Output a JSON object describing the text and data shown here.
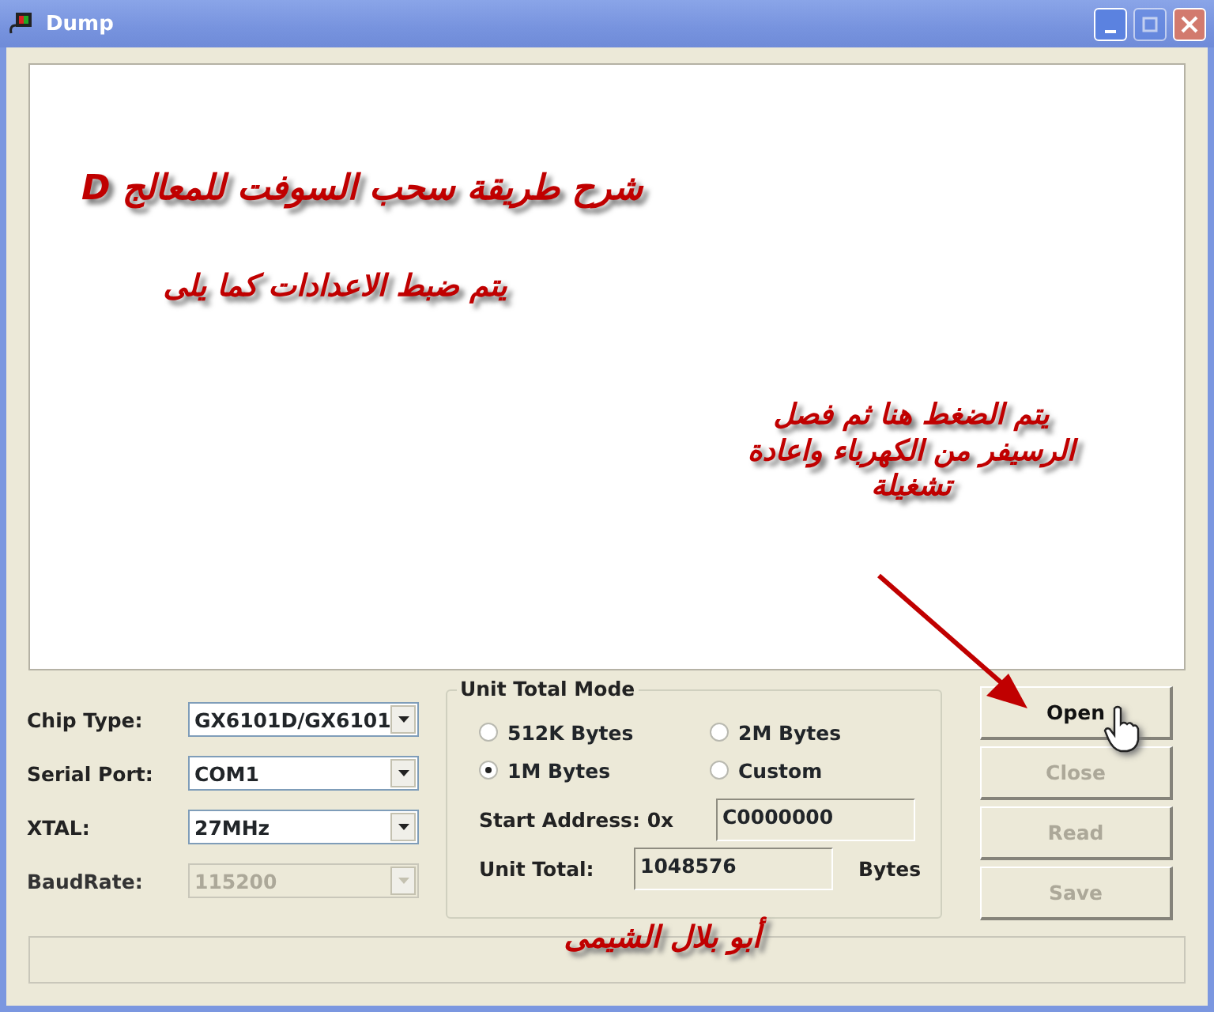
{
  "window": {
    "title": "Dump",
    "controls": [
      {
        "kind": "minimize",
        "disabled": false
      },
      {
        "kind": "maximize",
        "disabled": true
      },
      {
        "kind": "close",
        "disabled": false
      }
    ]
  },
  "settings": [
    {
      "label": "Chip Type:",
      "value": "GX6101D/GX6101",
      "disabled": false
    },
    {
      "label": "Serial Port:",
      "value": "COM1",
      "disabled": false
    },
    {
      "label": "XTAL:",
      "value": "27MHz",
      "disabled": false
    },
    {
      "label": "BaudRate:",
      "value": "115200",
      "disabled": true
    }
  ],
  "unit_total_mode": {
    "title": "Unit Total Mode",
    "options": [
      {
        "label": "512K Bytes",
        "selected": false
      },
      {
        "label": "2M Bytes",
        "selected": false
      },
      {
        "label": "1M Bytes",
        "selected": true
      },
      {
        "label": "Custom",
        "selected": false
      }
    ],
    "start_address": {
      "label": "Start Address: 0x",
      "value": "C0000000"
    },
    "unit_total": {
      "label": "Unit Total:",
      "value": "1048576",
      "unit": "Bytes"
    }
  },
  "buttons": [
    {
      "label": "Open",
      "disabled": false
    },
    {
      "label": "Close",
      "disabled": true
    },
    {
      "label": "Read",
      "disabled": true
    },
    {
      "label": "Save",
      "disabled": true
    }
  ],
  "annotations": [
    {
      "kind": "heading",
      "text": "شرح طريقة سحب السوفت للمعالج D"
    },
    {
      "kind": "subheading",
      "text": "يتم ضبط الاعدادات كما يلى"
    },
    {
      "kind": "note",
      "text": "يتم الضغط هنا ثم فصل الرسيفر من الكهرباء واعادة تشغيلة"
    },
    {
      "kind": "signature",
      "text": "أبو بلال الشيمى"
    }
  ]
}
